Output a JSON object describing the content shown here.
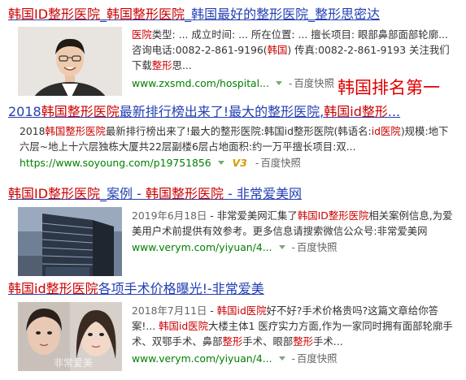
{
  "annotation": "韩国排名第一",
  "results": [
    {
      "title_parts": [
        {
          "t": "韩国ID整形医院",
          "hl": true
        },
        {
          "t": "_",
          "hl": false
        },
        {
          "t": "韩国整形医院",
          "hl": true
        },
        {
          "t": "_韩国最好的整形医院_整形思密达",
          "hl": false
        }
      ],
      "snippet_parts": [
        {
          "t": "医院",
          "hl": true
        },
        {
          "t": "类型: ... 成立时间: ... 所在位置: ... 擅长项目: 眼部鼻部面部轮廓...咨询电话:0082-2-861-9196(",
          "hl": false
        },
        {
          "t": "韩国",
          "hl": true
        },
        {
          "t": ") 传真:0082-2-861-9193 关注我们下载",
          "hl": false
        },
        {
          "t": "整形",
          "hl": true
        },
        {
          "t": "思...",
          "hl": false
        }
      ],
      "url": "www.zxsmd.com/hospital...",
      "snapshot": "百度快照",
      "thumb_icon": "doctor-portrait"
    },
    {
      "title_parts": [
        {
          "t": "2018",
          "hl": false
        },
        {
          "t": "韩国整形医院",
          "hl": true
        },
        {
          "t": "最新排行榜出来了!最大的整形医院,",
          "hl": false
        },
        {
          "t": "韩国id整形",
          "hl": true
        },
        {
          "t": "...",
          "hl": false
        }
      ],
      "snippet_parts": [
        {
          "t": "2018",
          "hl": false
        },
        {
          "t": "韩国整形医院",
          "hl": true
        },
        {
          "t": "最新排行榜出来了!最大的整形医院:韩国id整形医院(韩语名:",
          "hl": false
        },
        {
          "t": "id医院",
          "hl": true
        },
        {
          "t": ")规模:地下六层~地上十六层独栋大厦共22层副楼6层占地面积:约一万平擅长项目:双...",
          "hl": false
        }
      ],
      "url": "https://www.soyoung.com/p19751856",
      "badge": "V3",
      "snapshot": "百度快照"
    },
    {
      "title_parts": [
        {
          "t": "韩国ID整形医院",
          "hl": true
        },
        {
          "t": "_案例 - ",
          "hl": false
        },
        {
          "t": "韩国整形医院",
          "hl": true
        },
        {
          "t": " - 非常爱美网",
          "hl": false
        }
      ],
      "date": "2019年6月18日",
      "snippet_parts": [
        {
          "t": " - 非常爱美网汇集了",
          "hl": false
        },
        {
          "t": "韩国ID整形医院",
          "hl": true
        },
        {
          "t": "相关案例信息,为爱美用户术前提供有效参考。更多信息请搜索微信公众号:非常爱美网",
          "hl": false
        }
      ],
      "url": "www.verym.com/yiyuan/4...",
      "snapshot": "百度快照",
      "thumb_icon": "hospital-building"
    },
    {
      "title_parts": [
        {
          "t": "韩国id整形医院",
          "hl": true
        },
        {
          "t": "各项手术价格曝光!-非常爱美",
          "hl": false
        }
      ],
      "date": "2018年7月11日",
      "snippet_parts": [
        {
          "t": " - ",
          "hl": false
        },
        {
          "t": "韩国id医院",
          "hl": true
        },
        {
          "t": "好不好?手术价格贵吗?这篇文章给你答案!... ",
          "hl": false
        },
        {
          "t": "韩国id医院",
          "hl": true
        },
        {
          "t": "大楼主体1 医疗实力方面,作为一家同时拥有面部轮廓手术、双鄂手术、鼻部",
          "hl": false
        },
        {
          "t": "整形",
          "hl": true
        },
        {
          "t": "手术、眼部",
          "hl": false
        },
        {
          "t": "整形",
          "hl": true
        },
        {
          "t": "手术...",
          "hl": false
        }
      ],
      "url": "www.verym.com/yiyuan/4...",
      "snapshot": "百度快照",
      "thumb_icon": "two-women-photo",
      "watermark": "非常爱美"
    }
  ]
}
